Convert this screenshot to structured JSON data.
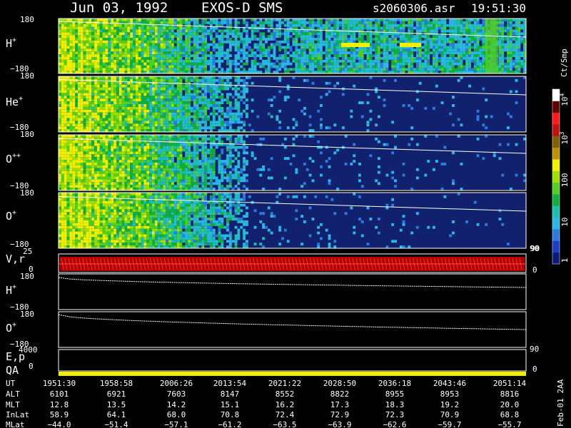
{
  "header": {
    "date": "Jun 03, 1992",
    "mission": "EXOS-D SMS",
    "file": "s2060306.asr",
    "time": "19:51:30"
  },
  "side_label": "Feb-01 2AA",
  "colorbar": {
    "label": "Ct/Smp",
    "ticks": [
      "1",
      "10",
      "100",
      "10",
      "10"
    ],
    "tick_exponents": [
      "",
      "",
      "",
      "3",
      "4"
    ],
    "colors": [
      "#0a1a7a",
      "#1a3ec8",
      "#2a7ae0",
      "#2ab8e8",
      "#1ac0b0",
      "#10b040",
      "#50d020",
      "#a0e000",
      "#f0f000",
      "#c09000",
      "#806000",
      "#c01010",
      "#ff1818",
      "#600000",
      "#ffffff"
    ]
  },
  "chart_data": [
    {
      "type": "heatmap",
      "panels": [
        {
          "label": "H",
          "charge": "+",
          "ylim": [
            -180,
            180
          ],
          "ytick_top": "180",
          "ytick_bottom": "−180"
        },
        {
          "label": "He",
          "charge": "+",
          "ylim": [
            -180,
            180
          ],
          "ytick_top": "180",
          "ytick_bottom": "−180"
        },
        {
          "label": "O",
          "charge": "++",
          "ylim": [
            -180,
            180
          ],
          "ytick_top": "180",
          "ytick_bottom": "−180"
        },
        {
          "label": "O",
          "charge": "+",
          "ylim": [
            -180,
            180
          ],
          "ytick_top": "180",
          "ytick_bottom": "−180"
        }
      ],
      "colorscale": "log counts"
    },
    {
      "type": "line",
      "label": "V,r",
      "yticks_left": [
        "25",
        "0"
      ],
      "yticks_right": [
        "90",
        "0"
      ]
    },
    {
      "type": "line",
      "panels": [
        {
          "label": "H",
          "charge": "+",
          "ytick_top": "180",
          "ytick_bottom": "−180"
        },
        {
          "label": "O",
          "charge": "+",
          "ytick_top": "180",
          "ytick_bottom": "−180"
        }
      ]
    },
    {
      "type": "line",
      "label": "E,p",
      "ytick_left": "4000",
      "ytick_right": "90"
    },
    {
      "type": "line",
      "label": "QA",
      "ytick_left": "0",
      "ytick_right": "0"
    },
    {
      "type": "table",
      "rows": [
        {
          "name": "UT",
          "values": [
            "1951:30",
            "1958:58",
            "2006:26",
            "2013:54",
            "2021:22",
            "2028:50",
            "2036:18",
            "2043:46",
            "2051:14"
          ]
        },
        {
          "name": "ALT",
          "values": [
            "6101",
            "6921",
            "7603",
            "8147",
            "8552",
            "8822",
            "8955",
            "8953",
            "8816"
          ]
        },
        {
          "name": "MLT",
          "values": [
            "12.8",
            "13.5",
            "14.2",
            "15.1",
            "16.2",
            "17.3",
            "18.3",
            "19.2",
            "20.0"
          ]
        },
        {
          "name": "InLat",
          "values": [
            "58.9",
            "64.1",
            "68.0",
            "70.8",
            "72.4",
            "72.9",
            "72.3",
            "70.9",
            "68.8"
          ]
        },
        {
          "name": "MLat",
          "values": [
            "−44.0",
            "−51.4",
            "−57.1",
            "−61.2",
            "−63.5",
            "−63.9",
            "−62.6",
            "−59.7",
            "−55.7"
          ]
        }
      ]
    }
  ]
}
